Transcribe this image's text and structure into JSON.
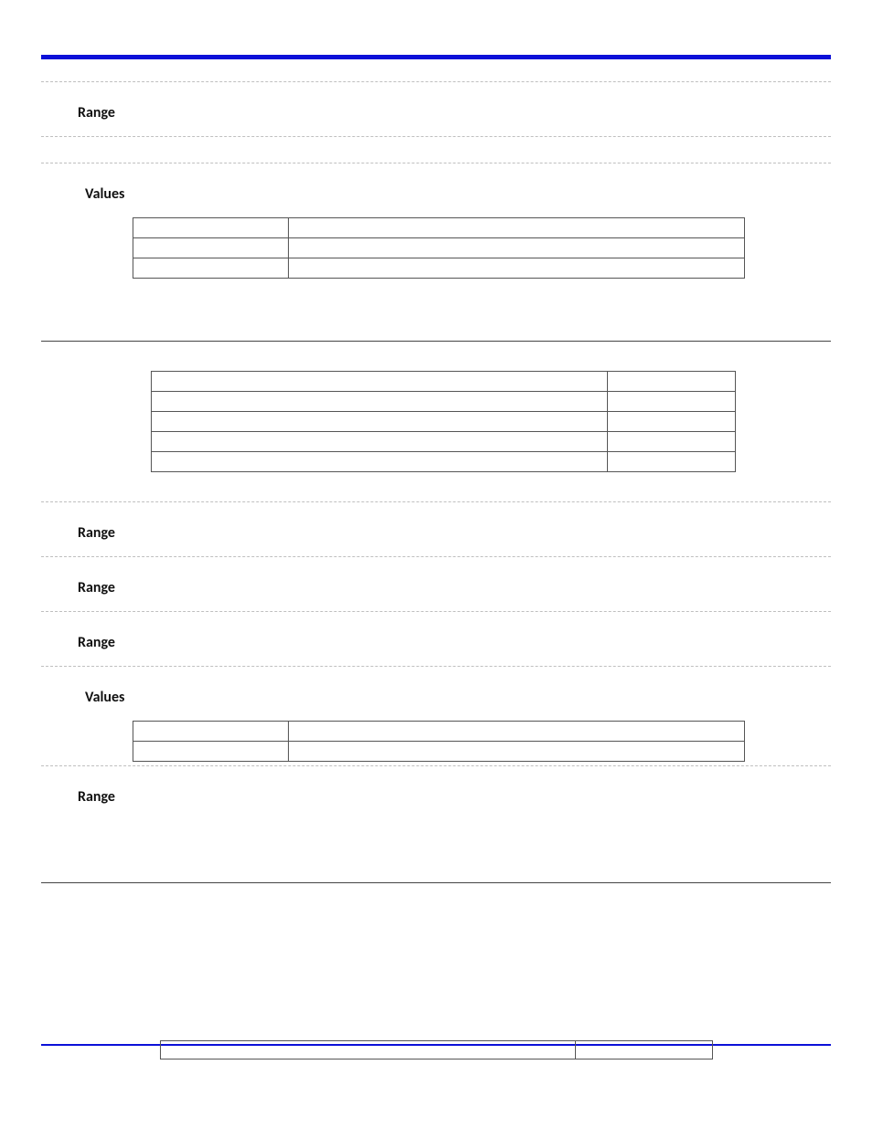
{
  "labels": {
    "range": "Range",
    "values": "Values"
  },
  "values_table_1": {
    "rows": [
      {
        "key": "",
        "val": ""
      },
      {
        "key": "",
        "val": ""
      },
      {
        "key": "",
        "val": ""
      }
    ]
  },
  "type_table": {
    "rows": [
      {
        "name": "",
        "type": ""
      },
      {
        "name": "",
        "type": ""
      },
      {
        "name": "",
        "type": ""
      },
      {
        "name": "",
        "type": ""
      },
      {
        "name": "",
        "type": ""
      }
    ]
  },
  "values_table_2": {
    "rows": [
      {
        "key": "",
        "val": ""
      },
      {
        "key": "",
        "val": ""
      }
    ]
  },
  "footer": {
    "center": "",
    "right": ""
  }
}
